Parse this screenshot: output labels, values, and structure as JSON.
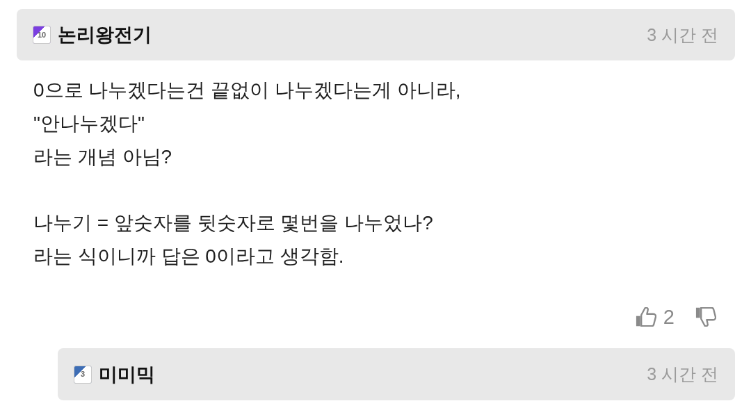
{
  "comments": [
    {
      "badge": {
        "text": "10",
        "color": "#7b3fe0"
      },
      "author": "논리왕전기",
      "time": "3 시간 전",
      "body": [
        "0으로 나누겠다는건 끝없이 나누겠다는게 아니라,\n\"안나누겠다\"\n라는 개념 아님?",
        "나누기 = 앞숫자를 뒷숫자로 몇번을 나누었나?\n라는 식이니까 답은 0이라고 생각함."
      ],
      "votes": {
        "up": "2"
      },
      "replies": [
        {
          "badge": {
            "text": "3",
            "color": "#3d6db5"
          },
          "author": "미미믹",
          "time": "3 시간 전"
        }
      ]
    }
  ]
}
